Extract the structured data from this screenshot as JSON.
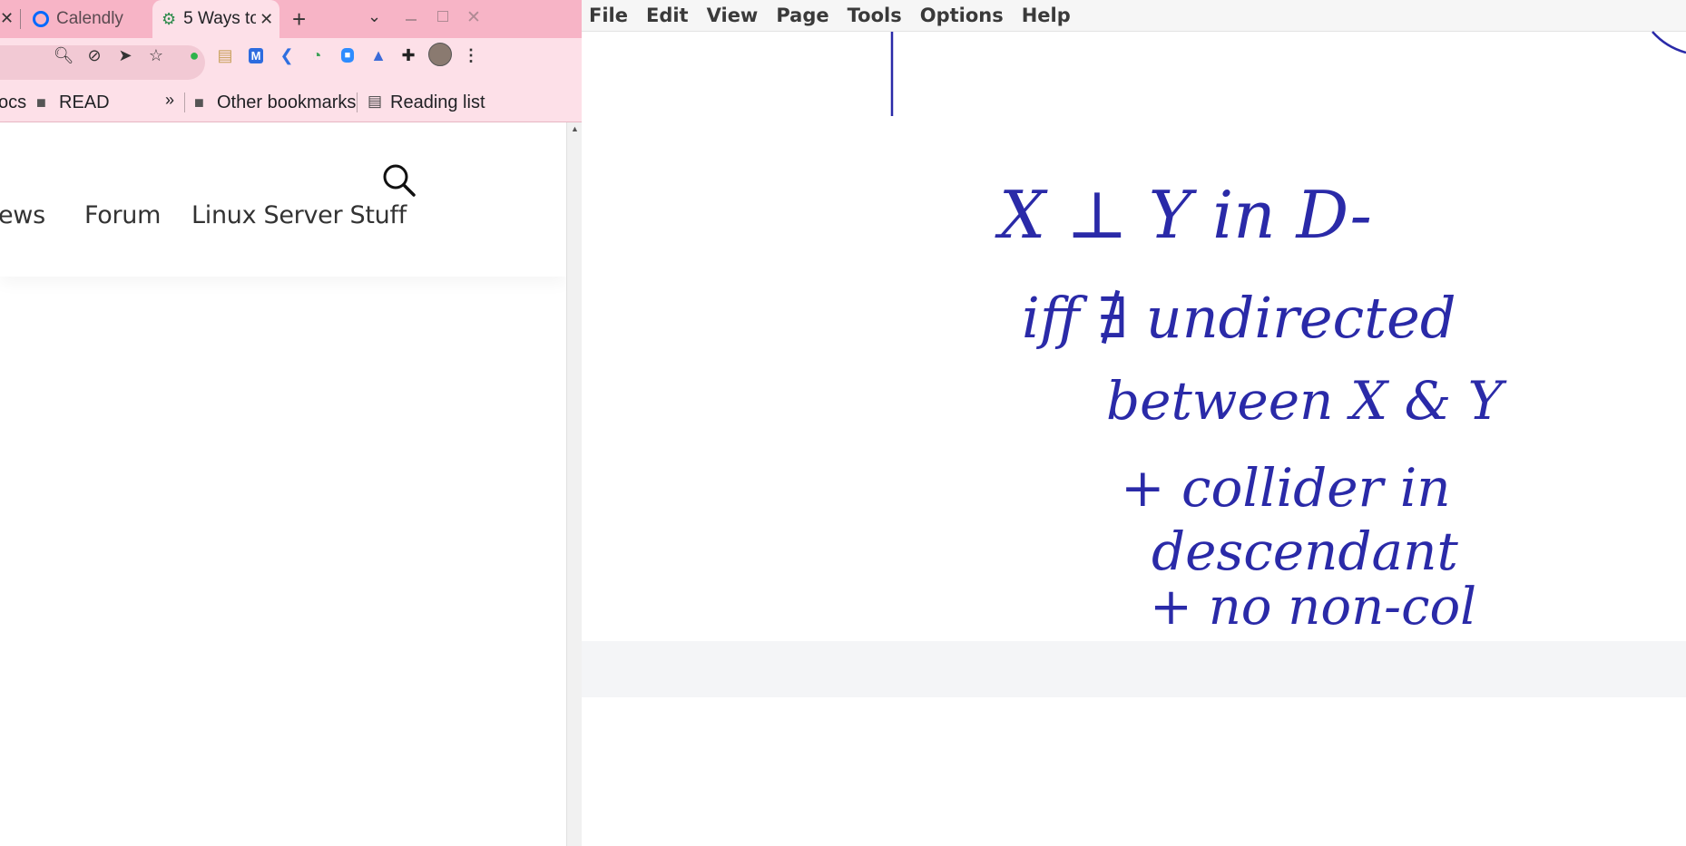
{
  "browser": {
    "tabs": [
      {
        "label": "Calendly",
        "icon": "calendly-icon"
      },
      {
        "label": "5 Ways to",
        "icon": "gear-logo-icon"
      }
    ],
    "new_tab": "+",
    "bookmarks": {
      "partial_left": "ocs",
      "read": "READ",
      "overflow": "»",
      "other": "Other bookmarks",
      "reading_list": "Reading list"
    },
    "site_nav": {
      "news_partial": "ews",
      "forum": "Forum",
      "linux": "Linux Server Stuff"
    }
  },
  "journal": {
    "menu": [
      "File",
      "Edit",
      "View",
      "Page",
      "Tools",
      "Options",
      "Help"
    ],
    "ink_color": "#2a2aa8",
    "handwriting_lines": [
      "X ⊥ Y in D-",
      "iff ∄ undirected",
      "between X & Y",
      "+ collider in",
      "descendant",
      "+ no non-col"
    ]
  }
}
